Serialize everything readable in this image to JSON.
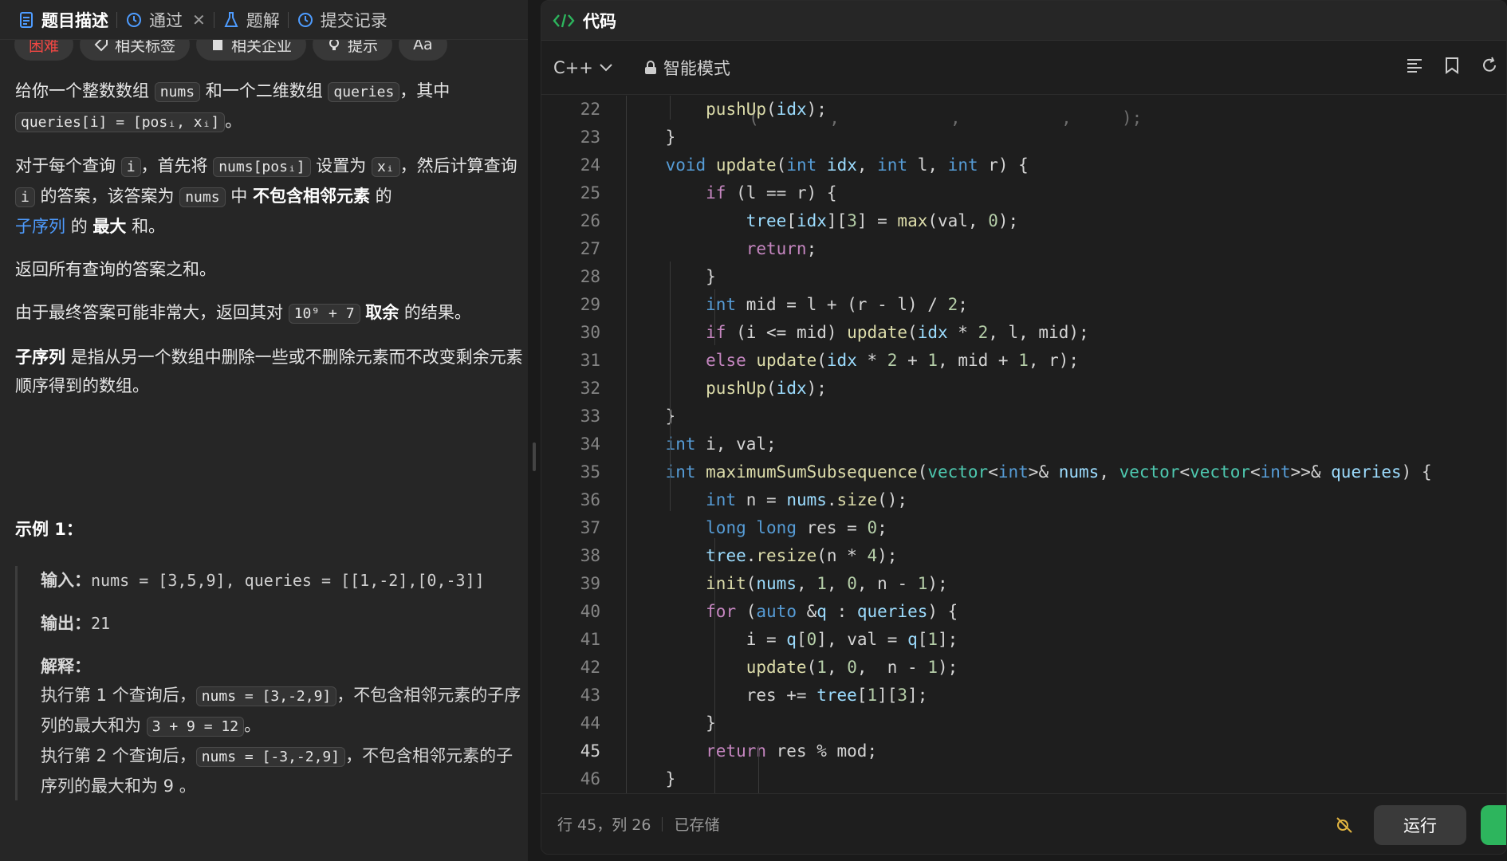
{
  "left_tabs": [
    {
      "label": "题目描述",
      "icon": "document-icon",
      "active": true
    },
    {
      "label": "通过",
      "icon": "history-icon",
      "active": false
    },
    {
      "label": "题解",
      "icon": "flask-icon",
      "active": false
    },
    {
      "label": "提交记录",
      "icon": "history-icon",
      "active": false
    }
  ],
  "tags": [
    "困难",
    "相关标签",
    "相关企业",
    "提示",
    "Aa"
  ],
  "problem": {
    "p1_a": "给你一个整数数组",
    "p1_nums": "nums",
    "p1_b": "和一个二维数组",
    "p1_queries": "queries",
    "p1_c": "，其中",
    "p1_code": "queries[i] = [posᵢ, xᵢ]",
    "p1_d": "。",
    "p2_a": "对于每个查询",
    "p2_i": "i",
    "p2_b": "，首先将",
    "p2_code": "nums[posᵢ]",
    "p2_c": "设置为",
    "p2_x": "xᵢ",
    "p2_d": "，然后计算查询",
    "p2_i2": "i",
    "p2_e": "的答案，该答案为",
    "p2_nums": "nums",
    "p2_f": "中",
    "p2_bold": "不包含相邻元素",
    "p2_g": "的",
    "p2_link": "子序列",
    "p2_h": "的",
    "p2_bold2": "最大",
    "p2_i3": "和。",
    "p3": "返回所有查询的答案之和。",
    "p4_a": "由于最终答案可能非常大，返回其对",
    "p4_code": "10⁹ + 7",
    "p4_bold": "取余",
    "p4_b": "的结果。",
    "p5_bold": "子序列",
    "p5_a": "是指从另一个数组中删除一些或不删除元素而不改变剩余元素顺序得到的数组。"
  },
  "example": {
    "title": "示例 1：",
    "input_label": "输入：",
    "input_value": "nums = [3,5,9], queries = [[1,-2],[0,-3]]",
    "output_label": "输出：",
    "output_value": "21",
    "explain_label": "解释：",
    "e1_a": "执行第 1 个查询后，",
    "e1_code": "nums = [3,-2,9]",
    "e1_b": "，不包含相邻元素的子序列的最大和为",
    "e1_code2": "3 + 9 = 12",
    "e1_c": "。",
    "e2_a": "执行第 2 个查询后，",
    "e2_code": "nums = [-3,-2,9]",
    "e2_b": "，不包含相邻元素的子序列的最大和为 9 。"
  },
  "right": {
    "title": "代码",
    "language": "C++",
    "mode": "智能模式",
    "status_pos": "行 45，列 26",
    "status_saved": "已存储",
    "run_label": "运行"
  },
  "code_lines": [
    {
      "n": "22",
      "html": "        pushUp(idx);"
    },
    {
      "n": "23",
      "html": "    }"
    },
    {
      "n": "24",
      "html": "    void update(int idx, int l, int r) {"
    },
    {
      "n": "25",
      "html": "        if (l == r) {"
    },
    {
      "n": "26",
      "html": "            tree[idx][3] = max(val, 0);"
    },
    {
      "n": "27",
      "html": "            return;"
    },
    {
      "n": "28",
      "html": "        }"
    },
    {
      "n": "29",
      "html": "        int mid = l + (r - l) / 2;"
    },
    {
      "n": "30",
      "html": "        if (i <= mid) update(idx * 2, l, mid);"
    },
    {
      "n": "31",
      "html": "        else update(idx * 2 + 1, mid + 1, r);"
    },
    {
      "n": "32",
      "html": "        pushUp(idx);"
    },
    {
      "n": "33",
      "html": "    }"
    },
    {
      "n": "34",
      "html": "    int i, val;"
    },
    {
      "n": "35",
      "html": "    int maximumSumSubsequence(vector<int>& nums, vector<vector<int>>& queries) {"
    },
    {
      "n": "36",
      "html": "        int n = nums.size();"
    },
    {
      "n": "37",
      "html": "        long long res = 0;"
    },
    {
      "n": "38",
      "html": "        tree.resize(n * 4);"
    },
    {
      "n": "39",
      "html": "        init(nums, 1, 0, n - 1);"
    },
    {
      "n": "40",
      "html": "        for (auto &q : queries) {"
    },
    {
      "n": "41",
      "html": "            i = q[0], val = q[1];"
    },
    {
      "n": "42",
      "html": "            update(1, 0,  n - 1);"
    },
    {
      "n": "43",
      "html": "            res += tree[1][3];"
    },
    {
      "n": "44",
      "html": "        }"
    },
    {
      "n": "45",
      "html": "        return res % mod;"
    },
    {
      "n": "46",
      "html": "    }"
    }
  ],
  "colors": {
    "accent_blue": "#4e9cff",
    "difficulty_red": "#ef4743",
    "submit_green": "#2db55d"
  }
}
